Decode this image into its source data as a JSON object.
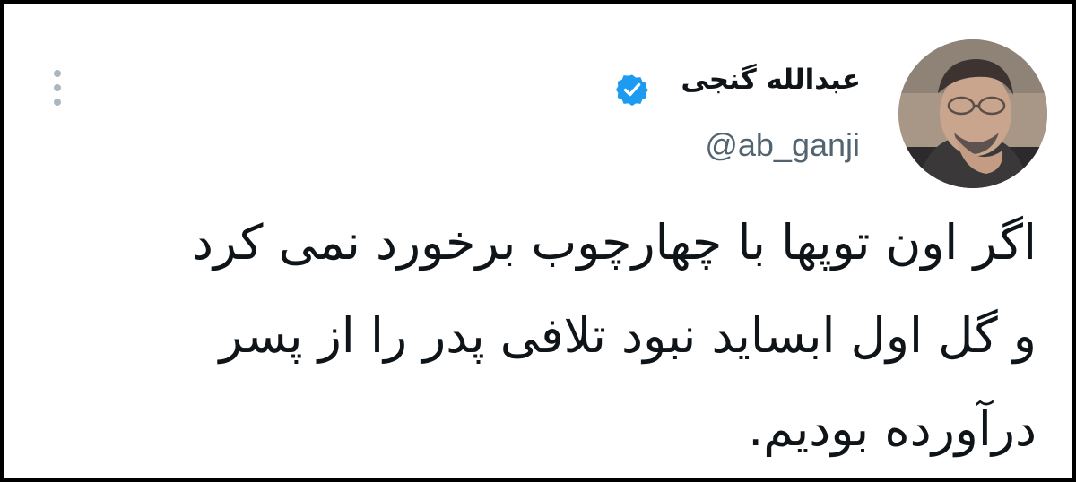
{
  "tweet": {
    "author": {
      "display_name": "عبدالله گنجی",
      "handle": "@ab_ganji",
      "avatar_icon": "profile-photo",
      "verified": true,
      "verified_icon": "verified-badge-icon"
    },
    "menu_icon": "more-options-icon",
    "text_lines": [
      "اگر اون توپها با چهارچوب برخورد نمی کرد",
      "و گل اول ابساید نبود تلافی پدر را از پسر",
      "درآورده بودیم."
    ]
  },
  "colors": {
    "text": "#0f1419",
    "secondary_text": "#536471",
    "verified_blue": "#1d9bf0",
    "menu_dots": "#aab8c2",
    "frame_border": "#000000"
  }
}
